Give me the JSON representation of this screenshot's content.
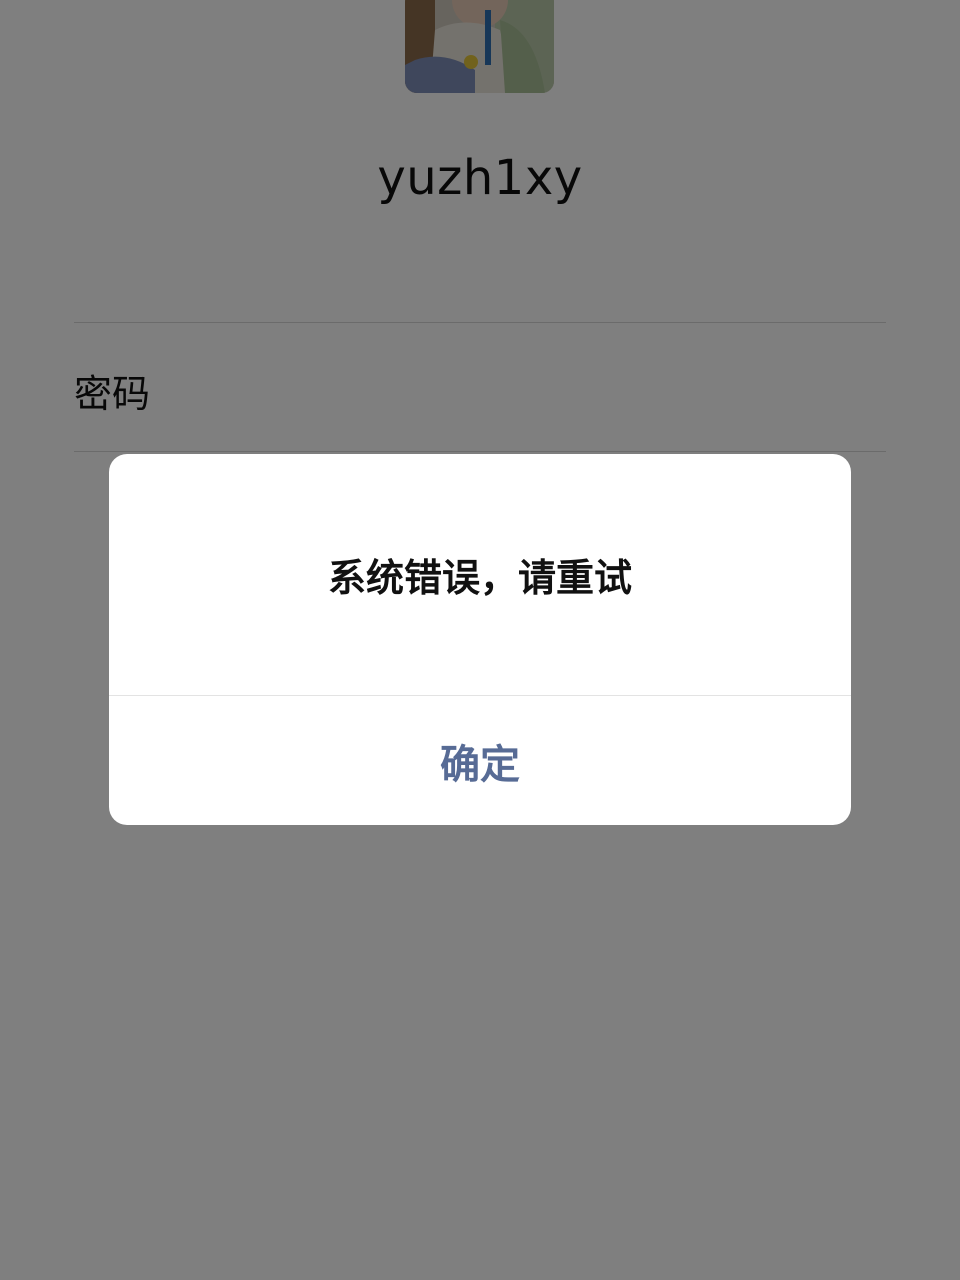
{
  "login": {
    "username": "yuzh1xy",
    "password_label": "密码"
  },
  "dialog": {
    "message": "系统错误，请重试",
    "confirm_label": "确定"
  },
  "colors": {
    "confirm_text": "#576b95",
    "overlay": "rgba(0,0,0,0.5)"
  }
}
